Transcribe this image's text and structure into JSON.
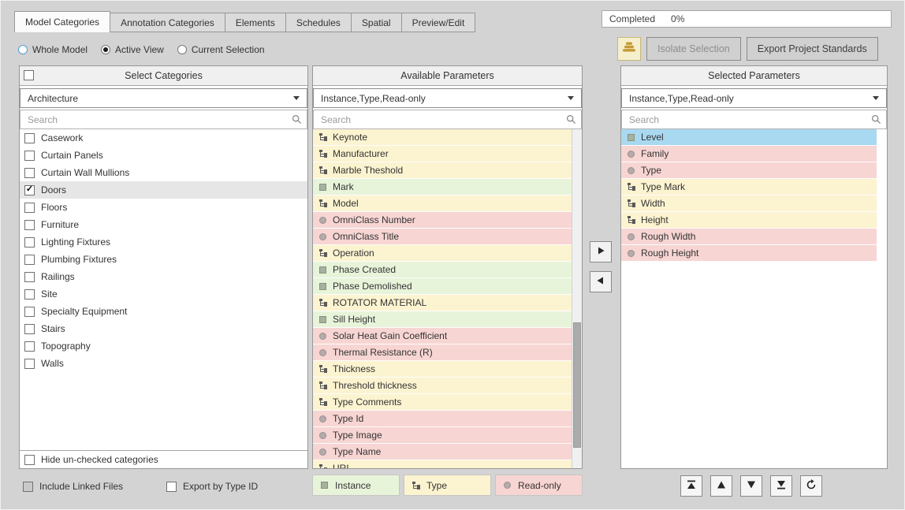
{
  "tabs": [
    {
      "label": "Model Categories",
      "active": true
    },
    {
      "label": "Annotation Categories",
      "active": false
    },
    {
      "label": "Elements",
      "active": false
    },
    {
      "label": "Schedules",
      "active": false
    },
    {
      "label": "Spatial",
      "active": false
    },
    {
      "label": "Preview/Edit",
      "active": false
    }
  ],
  "progress": {
    "label": "Completed",
    "value": "0%"
  },
  "scope_options": [
    {
      "label": "Whole Model",
      "selected": false,
      "focused": true
    },
    {
      "label": "Active View",
      "selected": true,
      "focused": false
    },
    {
      "label": "Current Selection",
      "selected": false,
      "focused": false
    }
  ],
  "toolbar": {
    "isolate_label": "Isolate Selection",
    "export_label": "Export Project Standards"
  },
  "categories_panel": {
    "title": "Select Categories",
    "discipline_value": "Architecture",
    "search_placeholder": "Search",
    "hide_unchecked_label": "Hide un-checked categories",
    "items": [
      {
        "label": "Casework",
        "checked": false
      },
      {
        "label": "Curtain Panels",
        "checked": false
      },
      {
        "label": "Curtain Wall Mullions",
        "checked": false
      },
      {
        "label": "Doors",
        "checked": true,
        "selected": true
      },
      {
        "label": "Floors",
        "checked": false
      },
      {
        "label": "Furniture",
        "checked": false
      },
      {
        "label": "Lighting Fixtures",
        "checked": false
      },
      {
        "label": "Plumbing Fixtures",
        "checked": false
      },
      {
        "label": "Railings",
        "checked": false
      },
      {
        "label": "Site",
        "checked": false
      },
      {
        "label": "Specialty Equipment",
        "checked": false
      },
      {
        "label": "Stairs",
        "checked": false
      },
      {
        "label": "Topography",
        "checked": false
      },
      {
        "label": "Walls",
        "checked": false
      }
    ]
  },
  "options": {
    "include_linked_label": "Include Linked Files",
    "export_by_type_label": "Export by Type ID"
  },
  "available_panel": {
    "title": "Available Parameters",
    "filter_value": "Instance,Type,Read-only",
    "search_placeholder": "Search",
    "items": [
      {
        "label": "Keynote",
        "kind": "type"
      },
      {
        "label": "Manufacturer",
        "kind": "type"
      },
      {
        "label": "Marble Theshold",
        "kind": "type"
      },
      {
        "label": "Mark",
        "kind": "instance"
      },
      {
        "label": "Model",
        "kind": "type"
      },
      {
        "label": "OmniClass Number",
        "kind": "readonly"
      },
      {
        "label": "OmniClass Title",
        "kind": "readonly"
      },
      {
        "label": "Operation",
        "kind": "type"
      },
      {
        "label": "Phase Created",
        "kind": "instance"
      },
      {
        "label": "Phase Demolished",
        "kind": "instance"
      },
      {
        "label": "ROTATOR MATERIAL",
        "kind": "type"
      },
      {
        "label": "Sill Height",
        "kind": "instance"
      },
      {
        "label": "Solar Heat Gain Coefficient",
        "kind": "readonly"
      },
      {
        "label": "Thermal Resistance (R)",
        "kind": "readonly"
      },
      {
        "label": "Thickness",
        "kind": "type"
      },
      {
        "label": "Threshold thickness",
        "kind": "type"
      },
      {
        "label": "Type Comments",
        "kind": "type"
      },
      {
        "label": "Type Id",
        "kind": "readonly"
      },
      {
        "label": "Type Image",
        "kind": "readonly"
      },
      {
        "label": "Type Name",
        "kind": "readonly"
      },
      {
        "label": "URL",
        "kind": "type"
      }
    ]
  },
  "selected_panel": {
    "title": "Selected Parameters",
    "filter_value": "Instance,Type,Read-only",
    "search_placeholder": "Search",
    "items": [
      {
        "label": "Level",
        "kind": "instance",
        "selected": true
      },
      {
        "label": "Family",
        "kind": "readonly"
      },
      {
        "label": "Type",
        "kind": "readonly"
      },
      {
        "label": "Type Mark",
        "kind": "type"
      },
      {
        "label": "Width",
        "kind": "type"
      },
      {
        "label": "Height",
        "kind": "type"
      },
      {
        "label": "Rough Width",
        "kind": "readonly"
      },
      {
        "label": "Rough Height",
        "kind": "readonly"
      }
    ]
  },
  "legend": [
    {
      "label": "Instance",
      "kind": "instance"
    },
    {
      "label": "Type",
      "kind": "type"
    },
    {
      "label": "Read-only",
      "kind": "readonly"
    }
  ],
  "icons": {
    "app_logo": "beehive",
    "search": "magnifier",
    "dropdown_caret": "triangle-down",
    "move_right": "triangle-right",
    "move_left": "triangle-left",
    "move_top": "triangle-up-bar",
    "move_up": "triangle-up",
    "move_down": "triangle-down",
    "move_bottom": "triangle-down-bar",
    "refresh": "circular-arrow",
    "instance_marker": "green-square",
    "type_marker": "hierarchy-glyph",
    "readonly_marker": "gray-circle"
  },
  "colors": {
    "type_row": "#fcf3d0",
    "instance_row": "#e8f4da",
    "readonly_row": "#f7d5d3",
    "selected_row": "#a9d9f1"
  }
}
